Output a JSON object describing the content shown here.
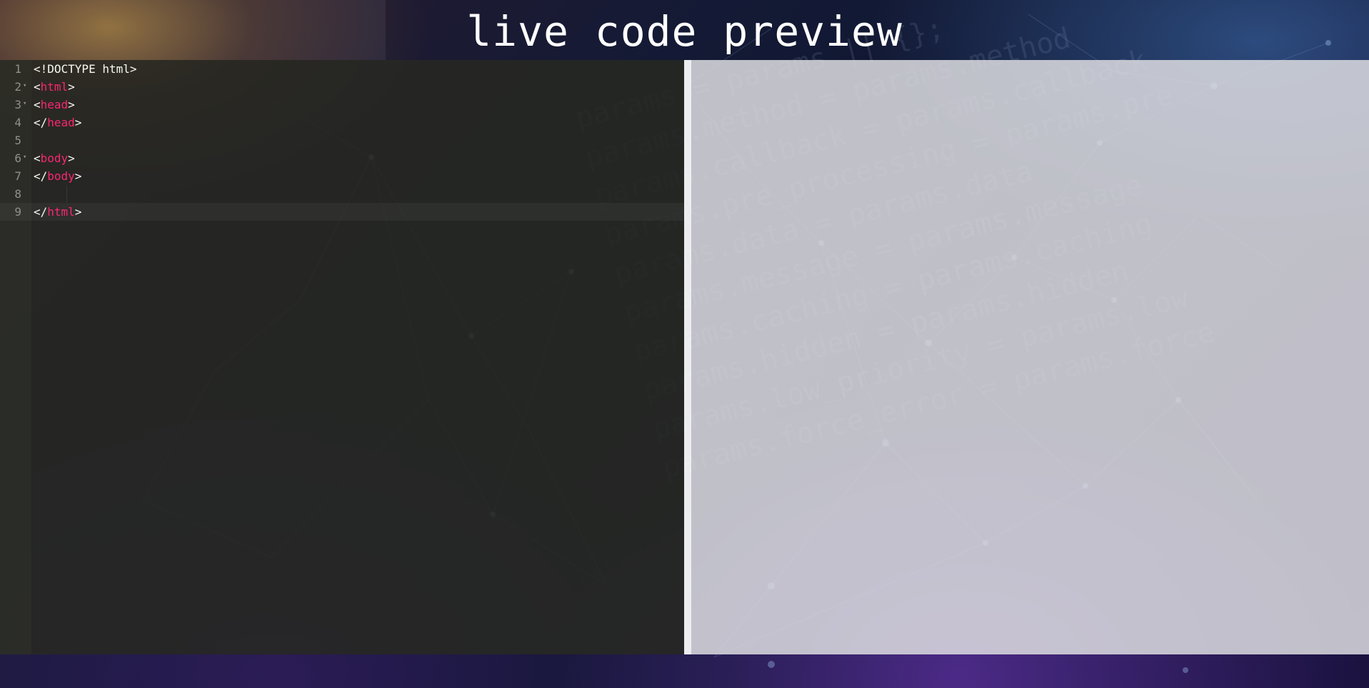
{
  "header": {
    "title": "live code preview"
  },
  "editor": {
    "lines": [
      {
        "number": "1",
        "fold": "",
        "parts": [
          [
            "doctype",
            "<!DOCTYPE html>"
          ]
        ]
      },
      {
        "number": "2",
        "fold": "▾",
        "parts": [
          [
            "punc",
            "<"
          ],
          [
            "tag",
            "html"
          ],
          [
            "punc",
            ">"
          ]
        ]
      },
      {
        "number": "3",
        "fold": "▾",
        "parts": [
          [
            "punc",
            "<"
          ],
          [
            "tag",
            "head"
          ],
          [
            "punc",
            ">"
          ]
        ]
      },
      {
        "number": "4",
        "fold": "",
        "parts": [
          [
            "punc",
            "</"
          ],
          [
            "tag",
            "head"
          ],
          [
            "punc",
            ">"
          ]
        ]
      },
      {
        "number": "5",
        "fold": "",
        "parts": []
      },
      {
        "number": "6",
        "fold": "▾",
        "parts": [
          [
            "punc",
            "<"
          ],
          [
            "tag",
            "body"
          ],
          [
            "punc",
            ">"
          ]
        ]
      },
      {
        "number": "7",
        "fold": "",
        "parts": [
          [
            "punc",
            "</"
          ],
          [
            "tag",
            "body"
          ],
          [
            "punc",
            ">"
          ]
        ]
      },
      {
        "number": "8",
        "fold": "",
        "parts": []
      },
      {
        "number": "9",
        "fold": "",
        "parts": [
          [
            "punc",
            "</"
          ],
          [
            "tag",
            "html"
          ],
          [
            "punc",
            ">"
          ]
        ]
      }
    ],
    "active_line": 9
  },
  "theme": {
    "editor_bg": "#272822",
    "tag_color": "#f92672",
    "text_color": "#f8f8f2",
    "gutter_text": "#8f908a",
    "preview_bg": "#dcdce1",
    "title_color": "#ffffff"
  },
  "icons": {
    "fold_marker": "fold-arrow-icon"
  }
}
